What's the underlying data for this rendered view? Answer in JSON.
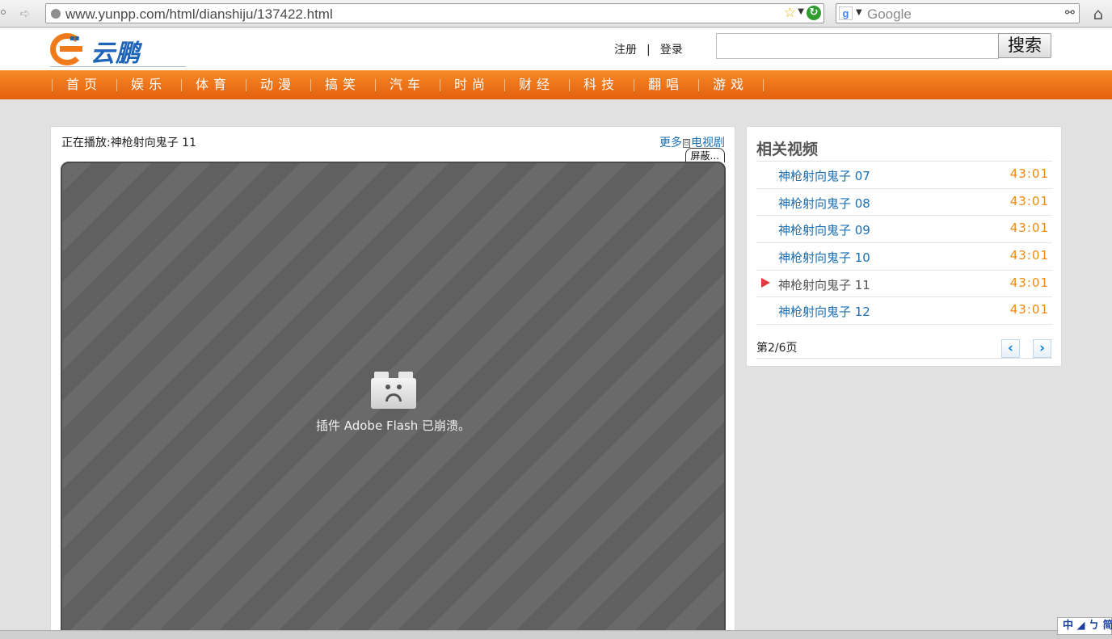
{
  "browser": {
    "url": "www.yunpp.com/html/dianshiju/137422.html",
    "search_engine": "Google"
  },
  "site": {
    "logo_text": "云鹏",
    "register": "注册",
    "separator": "|",
    "login": "登录",
    "search_button": "搜索",
    "search_value": ""
  },
  "nav": {
    "items": [
      {
        "label": "首页"
      },
      {
        "label": "娱乐"
      },
      {
        "label": "体育"
      },
      {
        "label": "动漫"
      },
      {
        "label": "搞笑"
      },
      {
        "label": "汽车"
      },
      {
        "label": "时尚"
      },
      {
        "label": "财经"
      },
      {
        "label": "科技"
      },
      {
        "label": "翻唱"
      },
      {
        "label": "游戏"
      }
    ]
  },
  "player": {
    "now_playing": "正在播放:神枪射向鬼子  11",
    "more_label": "更多",
    "more_icon_glyph": "日",
    "more_category": "电视剧",
    "block_button": "屏蔽...",
    "crash_message": "插件 Adobe Flash 已崩溃。"
  },
  "related": {
    "title": "相关视频",
    "items": [
      {
        "title": "神枪射向鬼子  07",
        "duration": "43:01",
        "current": false
      },
      {
        "title": "神枪射向鬼子  08",
        "duration": "43:01",
        "current": false
      },
      {
        "title": "神枪射向鬼子  09",
        "duration": "43:01",
        "current": false
      },
      {
        "title": "神枪射向鬼子  10",
        "duration": "43:01",
        "current": false
      },
      {
        "title": "神枪射向鬼子  11",
        "duration": "43:01",
        "current": true
      },
      {
        "title": "神枪射向鬼子  12",
        "duration": "43:01",
        "current": false
      }
    ],
    "pager": "第2/6页",
    "prev": "‹",
    "next": "›"
  },
  "ime": {
    "text": "中 ◢ ㄅ 简"
  }
}
